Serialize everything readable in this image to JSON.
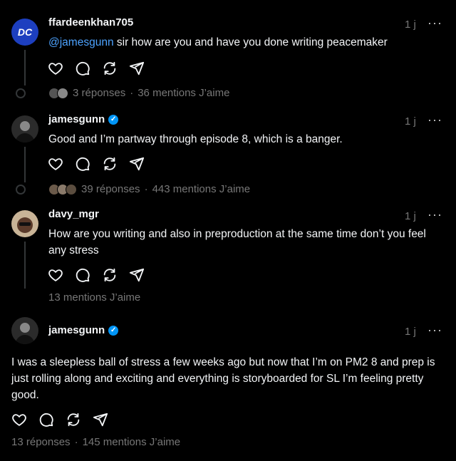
{
  "posts": [
    {
      "username": "ffardeenkhan705",
      "avatar_text": "DC",
      "time": "1 j",
      "more": "···",
      "mention": "@jamesgunn",
      "text": " sir how are you and have you done writing peacemaker",
      "replies": "3  réponses",
      "likes": "36 mentions J’aime"
    },
    {
      "username": "jamesgunn",
      "verified": true,
      "time": "1 j",
      "more": "···",
      "text": "Good and I’m partway through episode 8, which is a banger.",
      "replies": "39  réponses",
      "likes": "443 mentions J’aime"
    },
    {
      "username": "davy_mgr",
      "time": "1 j",
      "more": "···",
      "text": "How are you writing and also in preproduction at the same time don’t you feel any stress",
      "likes": "13 mentions J’aime"
    },
    {
      "username": "jamesgunn",
      "verified": true,
      "time": "1 j",
      "more": "···",
      "text": "I was a sleepless ball of stress a few weeks ago but now that I’m on PM2 8 and prep is just rolling along and exciting and everything is storyboarded for SL I’m feeling pretty good.",
      "replies": "13  réponses",
      "likes": "145 mentions J’aime"
    }
  ],
  "separator": "·",
  "icons": [
    "heart-icon",
    "comment-icon",
    "repost-icon",
    "share-icon"
  ],
  "colors": {
    "background": "#000000",
    "text": "#f3f5f7",
    "muted": "#777777",
    "mention": "#4da3ff",
    "verified": "#0095f6"
  }
}
